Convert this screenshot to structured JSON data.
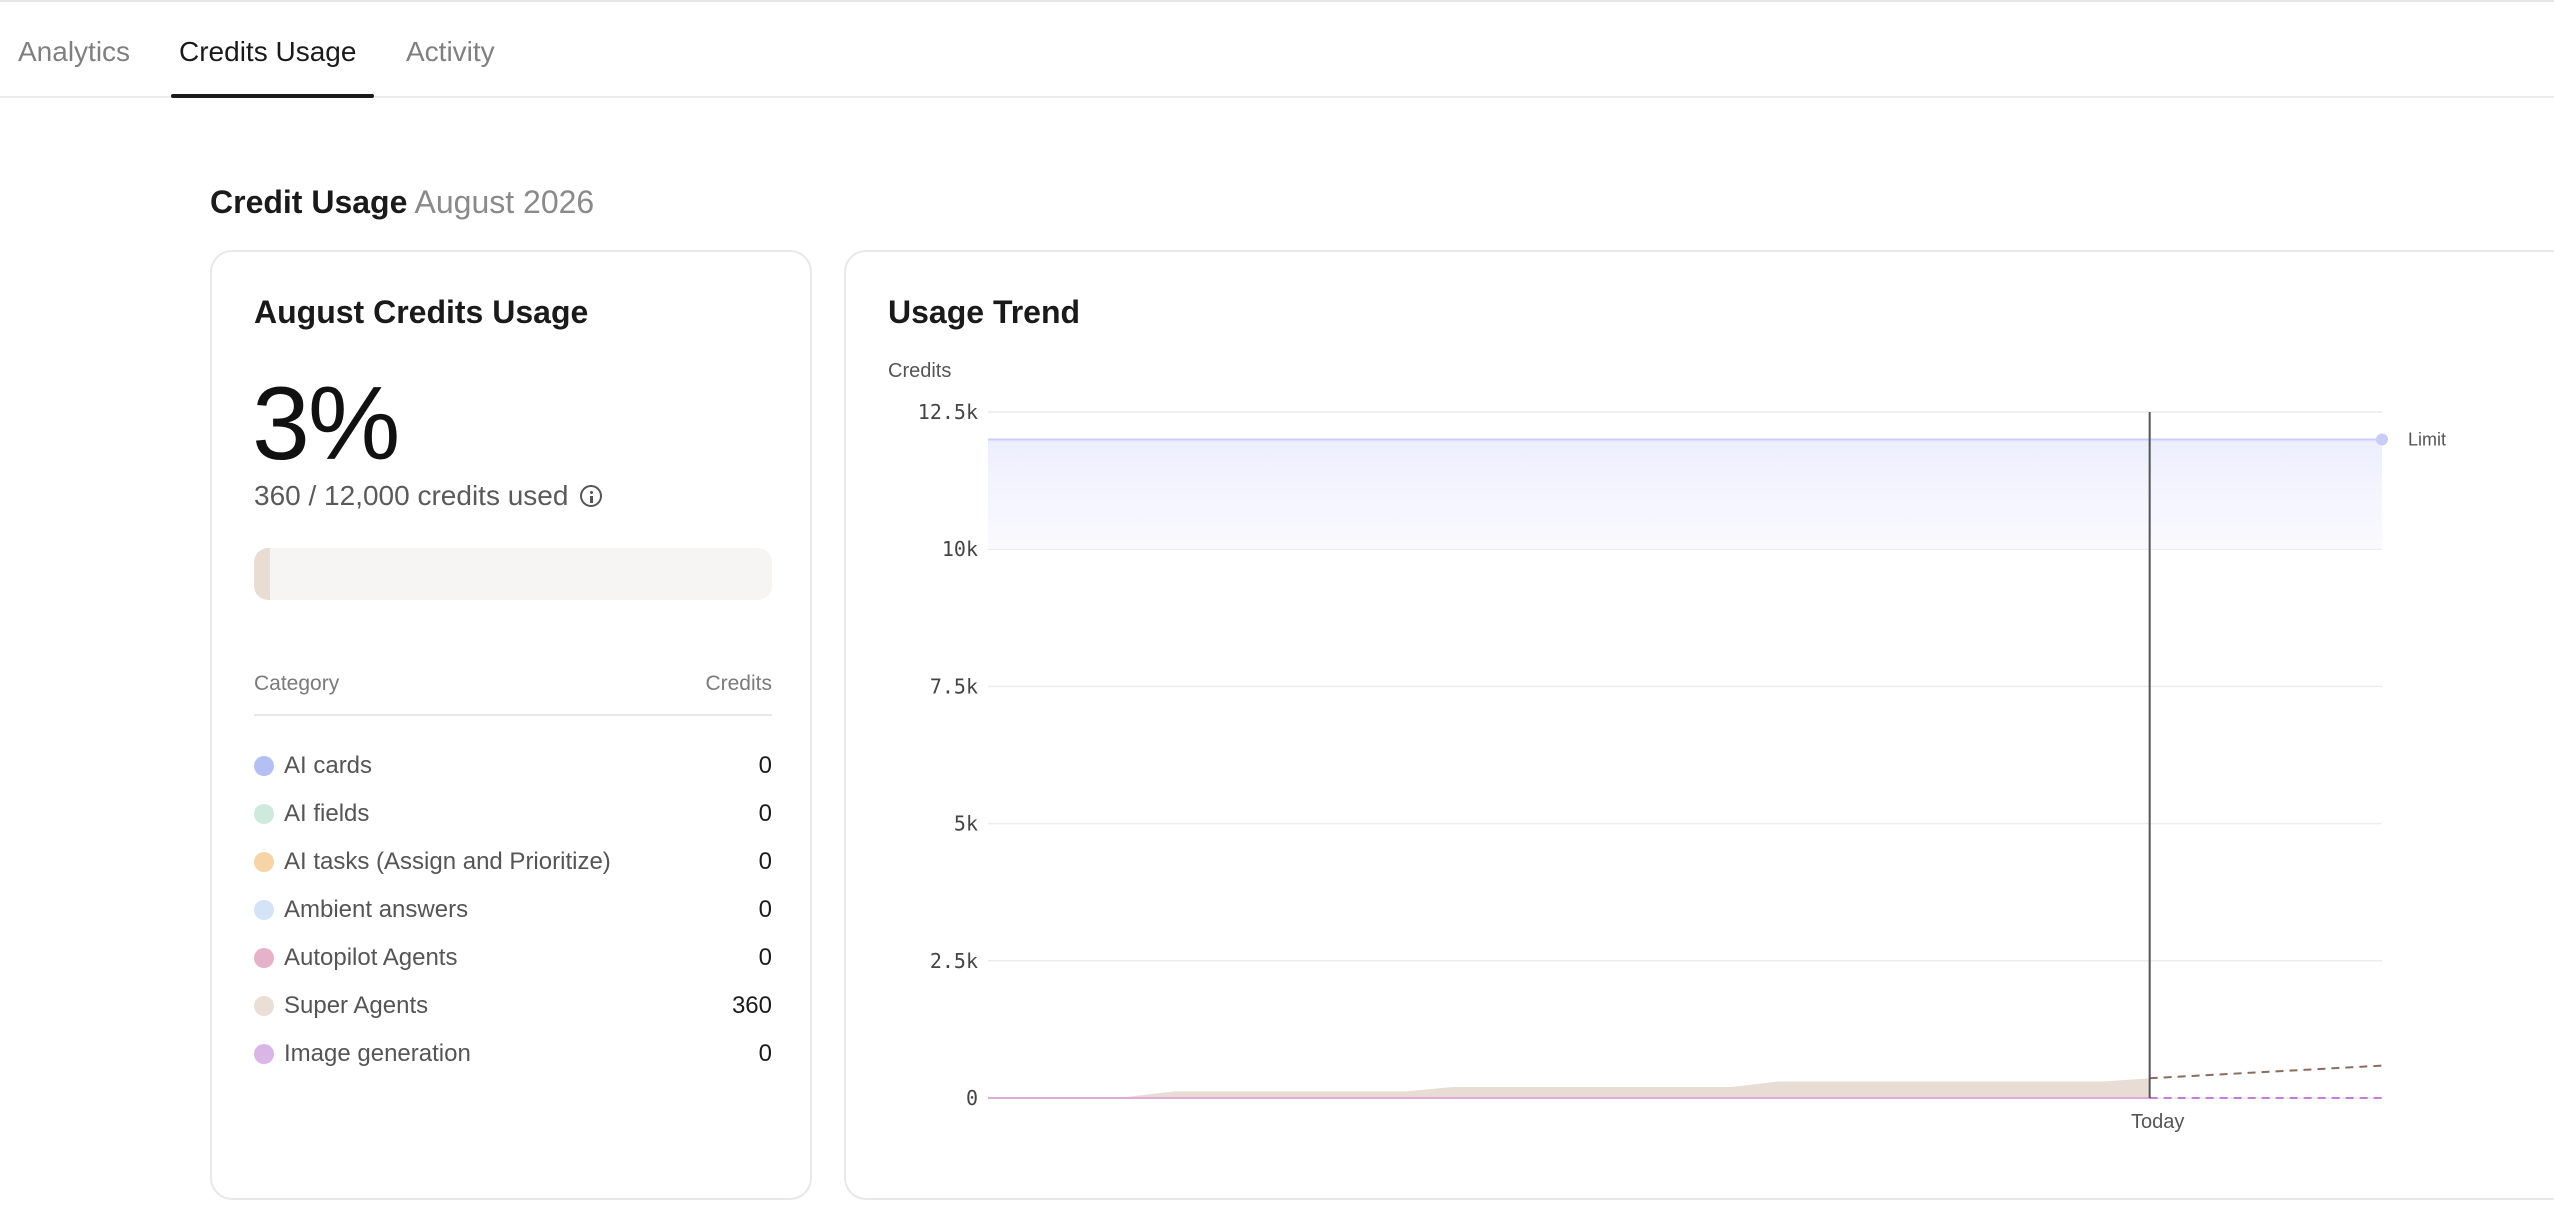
{
  "tabs": [
    {
      "label": "Analytics",
      "active": false
    },
    {
      "label": "Credits Usage",
      "active": true
    },
    {
      "label": "Activity",
      "active": false
    }
  ],
  "section": {
    "title": "Credit Usage",
    "period": "August 2026"
  },
  "summary_card": {
    "title": "August Credits Usage",
    "percent": "3%",
    "usage_text": "360 / 12,000 credits used",
    "progress_fraction": 0.03,
    "columns": {
      "category": "Category",
      "credits": "Credits"
    },
    "rows": [
      {
        "label": "AI cards",
        "value": "0",
        "color": "#b4c0f3"
      },
      {
        "label": "AI fields",
        "value": "0",
        "color": "#cfe9df"
      },
      {
        "label": "AI tasks (Assign and Prioritize)",
        "value": "0",
        "color": "#f7d3a8"
      },
      {
        "label": "Ambient answers",
        "value": "0",
        "color": "#d5e3f7"
      },
      {
        "label": "Autopilot Agents",
        "value": "0",
        "color": "#e6b2c9"
      },
      {
        "label": "Super Agents",
        "value": "360",
        "color": "#eadfd6"
      },
      {
        "label": "Image generation",
        "value": "0",
        "color": "#d9b6e6"
      }
    ]
  },
  "trend_card": {
    "title": "Usage Trend"
  },
  "chart_data": {
    "type": "area",
    "title": "Usage Trend",
    "ylabel": "Credits",
    "ylim": [
      0,
      12500
    ],
    "yticks": [
      {
        "value": 0,
        "label": "0"
      },
      {
        "value": 2500,
        "label": "2.5k"
      },
      {
        "value": 5000,
        "label": "5k"
      },
      {
        "value": 7500,
        "label": "7.5k"
      },
      {
        "value": 10000,
        "label": "10k"
      },
      {
        "value": 12500,
        "label": "12.5k"
      }
    ],
    "x_domain": [
      1,
      31
    ],
    "today_day": 26,
    "today_label": "Today",
    "limit": {
      "label": "Limit",
      "value": 12000,
      "color": "#c9cdf6"
    },
    "series": [
      {
        "category": "Super Agents",
        "color": "#e7ddd4",
        "x": [
          1,
          2,
          3,
          4,
          5,
          6,
          7,
          8,
          9,
          10,
          11,
          12,
          13,
          14,
          15,
          16,
          17,
          18,
          19,
          20,
          21,
          22,
          23,
          24,
          25,
          26
        ],
        "y": [
          0,
          0,
          0,
          20,
          120,
          120,
          120,
          120,
          120,
          120,
          200,
          200,
          200,
          200,
          200,
          200,
          200,
          300,
          300,
          300,
          300,
          300,
          300,
          300,
          300,
          360
        ]
      }
    ],
    "projection": {
      "x": [
        26,
        31
      ],
      "y": [
        360,
        590
      ],
      "color": "#8a6d5f",
      "zero_color": "#c77ae0"
    },
    "baseline_color": "#e2a8d8"
  }
}
